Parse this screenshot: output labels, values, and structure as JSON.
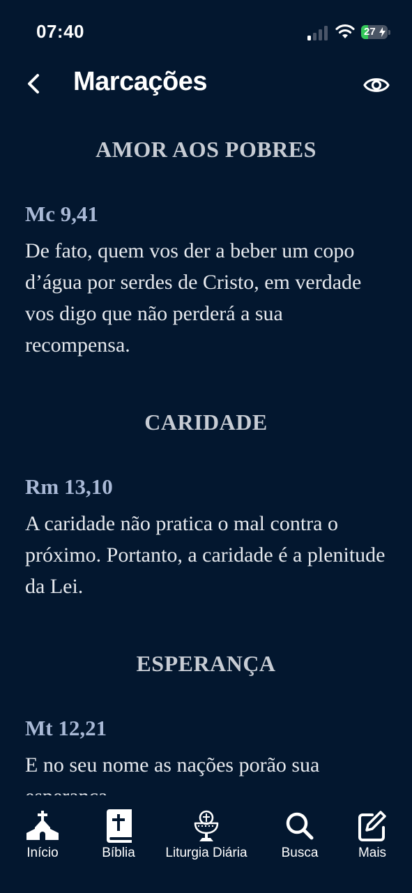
{
  "status_bar": {
    "time": "07:40",
    "battery": "27",
    "battery_level": 0.27,
    "signal_bars": 1
  },
  "header": {
    "title": "Marcações",
    "back_icon": "chevron-left-icon",
    "visibility_icon": "eye-icon"
  },
  "sections": [
    {
      "title": "AMOR AOS POBRES",
      "reference": "Mc 9,41",
      "text": "De fato, quem vos der a beber um copo d’água por serdes de Cristo, em verdade vos digo que não perderá a sua recompensa."
    },
    {
      "title": "CARIDADE",
      "reference": "Rm 13,10",
      "text": "A caridade não pratica o mal contra o próximo. Portanto, a caridade é a plenitude da Lei."
    },
    {
      "title": "ESPERANÇA",
      "reference": "Mt 12,21",
      "text": "E no seu nome as nações porão sua esperança."
    }
  ],
  "nav": {
    "items": [
      {
        "label": "Início",
        "icon": "church-icon"
      },
      {
        "label": "Bíblia",
        "icon": "bible-icon"
      },
      {
        "label": "Liturgia Diária",
        "icon": "chalice-icon"
      },
      {
        "label": "Busca",
        "icon": "search-icon"
      },
      {
        "label": "Mais",
        "icon": "edit-icon"
      }
    ]
  },
  "colors": {
    "background": "#03172f",
    "section_title": "#c7ccd4",
    "reference": "#a9b9d6",
    "battery_green": "#34c759"
  }
}
